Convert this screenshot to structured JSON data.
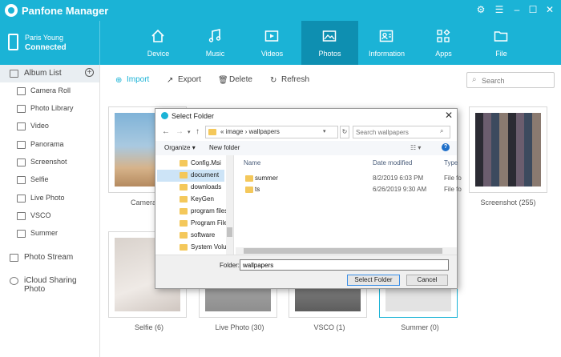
{
  "app": {
    "title": "Panfone Manager"
  },
  "device": {
    "user": "Paris Young",
    "status": "Connected"
  },
  "nav": {
    "tabs": [
      {
        "label": "Device",
        "icon": "home-icon"
      },
      {
        "label": "Music",
        "icon": "music-icon"
      },
      {
        "label": "Videos",
        "icon": "video-icon"
      },
      {
        "label": "Photos",
        "icon": "photo-icon",
        "active": true
      },
      {
        "label": "Information",
        "icon": "contacts-icon"
      },
      {
        "label": "Apps",
        "icon": "apps-icon"
      },
      {
        "label": "File",
        "icon": "folder-icon"
      }
    ]
  },
  "sidebar": {
    "album_list": "Album List",
    "items": [
      "Camera Roll",
      "Photo Library",
      "Video",
      "Panorama",
      "Screenshot",
      "Selfie",
      "Live Photo",
      "VSCO",
      "Summer"
    ],
    "photo_stream": "Photo Stream",
    "icloud": "iCloud Sharing Photo"
  },
  "toolbar": {
    "import": "Import",
    "export": "Export",
    "delete": "Delete",
    "refresh": "Refresh",
    "search_placeholder": "Search"
  },
  "albums": [
    {
      "name": "Camera Ro"
    },
    {
      "name": "Screenshot (255)"
    },
    {
      "name": "Selfie (6)"
    },
    {
      "name": "Live Photo (30)"
    },
    {
      "name": "VSCO (1)"
    },
    {
      "name": "Summer (0)"
    }
  ],
  "dialog": {
    "title": "Select Folder",
    "path": [
      "image",
      "wallpapers"
    ],
    "search_placeholder": "Search wallpapers",
    "organize": "Organize",
    "new_folder": "New folder",
    "tree": [
      "Config.Msi",
      "document",
      "downloads",
      "KeyGen",
      "program files",
      "Program Files",
      "software",
      "System Volun"
    ],
    "tree_selected": "document",
    "columns": {
      "name": "Name",
      "date": "Date modified",
      "type": "Type"
    },
    "files": [
      {
        "name": "summer",
        "date": "8/2/2019 6:03 PM",
        "type": "File fo"
      },
      {
        "name": "ts",
        "date": "6/26/2019 9:30 AM",
        "type": "File fo"
      }
    ],
    "folder_label": "Folder:",
    "folder_value": "wallpapers",
    "select_button": "Select Folder",
    "cancel_button": "Cancel"
  },
  "colors": {
    "brand": "#1bb3d6",
    "active_tab": "#0e8fb1"
  }
}
